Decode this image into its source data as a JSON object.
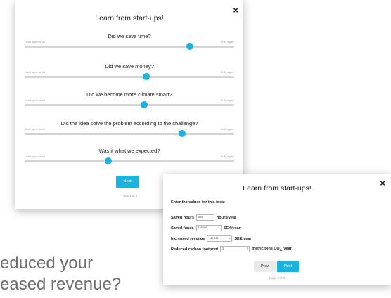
{
  "background": {
    "line1": "educed your",
    "line2": "eased revenue?"
  },
  "survey": {
    "title": "Learn from start-ups!",
    "close_label": "×",
    "left_label": "Don't agree at all",
    "right_label": "Fully agree",
    "questions": [
      {
        "text": "Did we save time?",
        "value": 0.79
      },
      {
        "text": "Did we save money?",
        "value": 0.58
      },
      {
        "text": "Did we become more climate smart?",
        "value": 0.57
      },
      {
        "text": "Did the idea solve the problem according to the challenge?",
        "value": 0.75
      },
      {
        "text": "Was it what we expected?",
        "value": 0.4
      }
    ],
    "next_label": "Next",
    "pager": "Page 1 of 4"
  },
  "values_form": {
    "title": "Learn from start-ups!",
    "close_label": "×",
    "intro": "Enter the values for this idea:",
    "fields": [
      {
        "label": "Saved hours",
        "value": "500",
        "unit": "hours/year"
      },
      {
        "label": "Saved funds",
        "value": "100 000",
        "unit": "SEK/year"
      },
      {
        "label": "Increased revenue",
        "value": "200 000",
        "unit": "SEK/year"
      },
      {
        "label": "Reduced carbon footprint",
        "value": "3",
        "unit": "metric tons CO",
        "unit_sub": "2e",
        "unit_after": "/year"
      }
    ],
    "prev_label": "Prev",
    "next_label": "Next",
    "pager": "Page 3 of 4"
  },
  "colors": {
    "accent": "#1ab3de",
    "track": "#d3d3d3"
  }
}
